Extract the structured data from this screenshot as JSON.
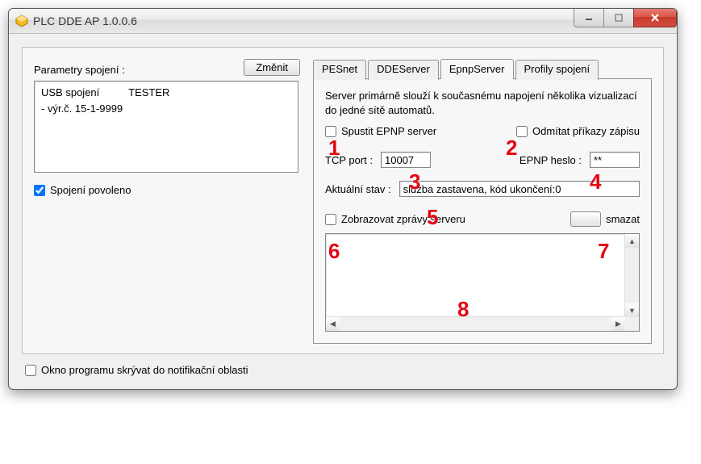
{
  "window": {
    "title": "PLC DDE AP 1.0.0.6"
  },
  "left": {
    "param_label": "Parametry spojení :",
    "change_btn": "Změnit",
    "list_line1": "USB spojení          TESTER",
    "list_line2": "- výr.č. 15-1-9999",
    "conn_enabled_label": "Spojení povoleno",
    "conn_enabled_checked": true
  },
  "tabs": {
    "t1": "PESnet",
    "t2": "DDEServer",
    "t3": "EpnpServer",
    "t4": "Profily spojení"
  },
  "epnp": {
    "desc": "Server primárně slouží k současnému napojení několika vizualizací do jedné sítě automatů.",
    "run_label": "Spustit EPNP server",
    "reject_label": "Odmítat příkazy zápisu",
    "tcp_label": "TCP port :",
    "tcp_value": "10007",
    "pass_label": "EPNP heslo :",
    "pass_value": "**",
    "status_label": "Aktuální stav :",
    "status_value": "služba zastavena, kód ukončení:0",
    "show_msgs_label": "Zobrazovat zprávy serveru",
    "clear_btn": "smazat"
  },
  "bottom": {
    "tray_label": "Okno programu skrývat do notifikační oblasti"
  },
  "marks": {
    "m1": "1",
    "m2": "2",
    "m3": "3",
    "m4": "4",
    "m5": "5",
    "m6": "6",
    "m7": "7",
    "m8": "8"
  }
}
